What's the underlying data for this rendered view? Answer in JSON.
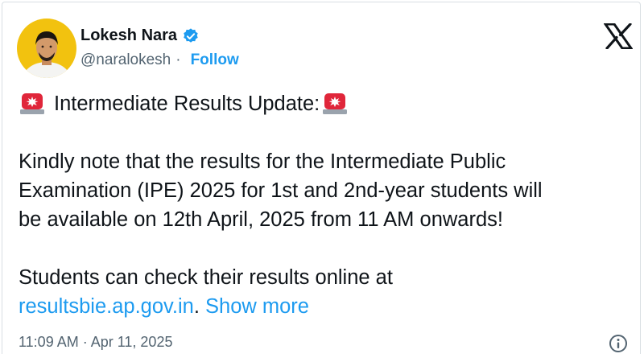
{
  "author": {
    "name": "Lokesh Nara",
    "handle": "@naralokesh",
    "separator": "·",
    "follow_label": "Follow",
    "verified": true
  },
  "post": {
    "heading": "Intermediate Results Update:",
    "paragraph1_lines": [
      "Kindly note that the results for the Intermediate Public",
      "Examination (IPE) 2025 for 1st and 2nd-year students will",
      "be available on 12th April, 2025 from 11 AM onwards!"
    ],
    "paragraph2_line1": "Students can check their results online at",
    "link_text": "resultsbie.ap.gov.in",
    "after_link": ".",
    "show_more": "Show more"
  },
  "meta": {
    "timestamp": "11:09 AM · Apr 11, 2025"
  },
  "icons": {
    "verified": "verified-badge-icon",
    "siren": "police-light-icon",
    "brand": "x-logo-icon",
    "info": "info-icon"
  },
  "colors": {
    "accent": "#1d9bf0",
    "text": "#0f1419",
    "muted": "#536471"
  }
}
